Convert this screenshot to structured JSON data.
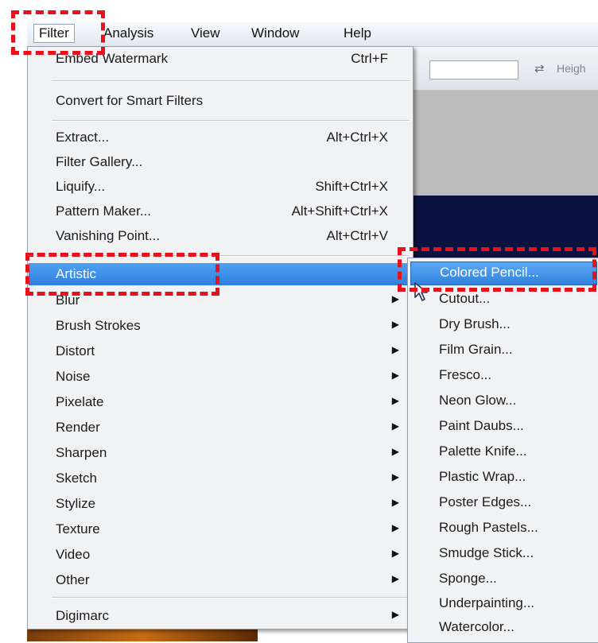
{
  "menubar": {
    "items": [
      "Filter",
      "Analysis",
      "View",
      "Window",
      "Help"
    ],
    "active_index": 0
  },
  "options_bar": {
    "swap_icon": "swap-arrows-icon",
    "height_label": "Heigh"
  },
  "filter_menu": {
    "embed_watermark": {
      "label": "Embed Watermark",
      "shortcut": "Ctrl+F"
    },
    "convert_smart": {
      "label": "Convert for Smart Filters"
    },
    "extract": {
      "label": "Extract...",
      "shortcut": "Alt+Ctrl+X"
    },
    "filter_gallery": {
      "label": "Filter Gallery..."
    },
    "liquify": {
      "label": "Liquify...",
      "shortcut": "Shift+Ctrl+X"
    },
    "pattern_maker": {
      "label": "Pattern Maker...",
      "shortcut": "Alt+Shift+Ctrl+X"
    },
    "vanishing_point": {
      "label": "Vanishing Point...",
      "shortcut": "Alt+Ctrl+V"
    },
    "submenus": [
      "Artistic",
      "Blur",
      "Brush Strokes",
      "Distort",
      "Noise",
      "Pixelate",
      "Render",
      "Sharpen",
      "Sketch",
      "Stylize",
      "Texture",
      "Video",
      "Other"
    ],
    "digimarc": {
      "label": "Digimarc"
    },
    "highlighted": "Artistic"
  },
  "artistic_submenu": {
    "items": [
      "Colored Pencil...",
      "Cutout...",
      "Dry Brush...",
      "Film Grain...",
      "Fresco...",
      "Neon Glow...",
      "Paint Daubs...",
      "Palette Knife...",
      "Plastic Wrap...",
      "Poster Edges...",
      "Rough Pastels...",
      "Smudge Stick...",
      "Sponge...",
      "Underpainting...",
      "Watercolor..."
    ],
    "highlighted": "Colored Pencil..."
  },
  "colors": {
    "highlight": "#3282dd",
    "annotation": "#e8101a",
    "menu_bg": "#f1f2f4"
  }
}
